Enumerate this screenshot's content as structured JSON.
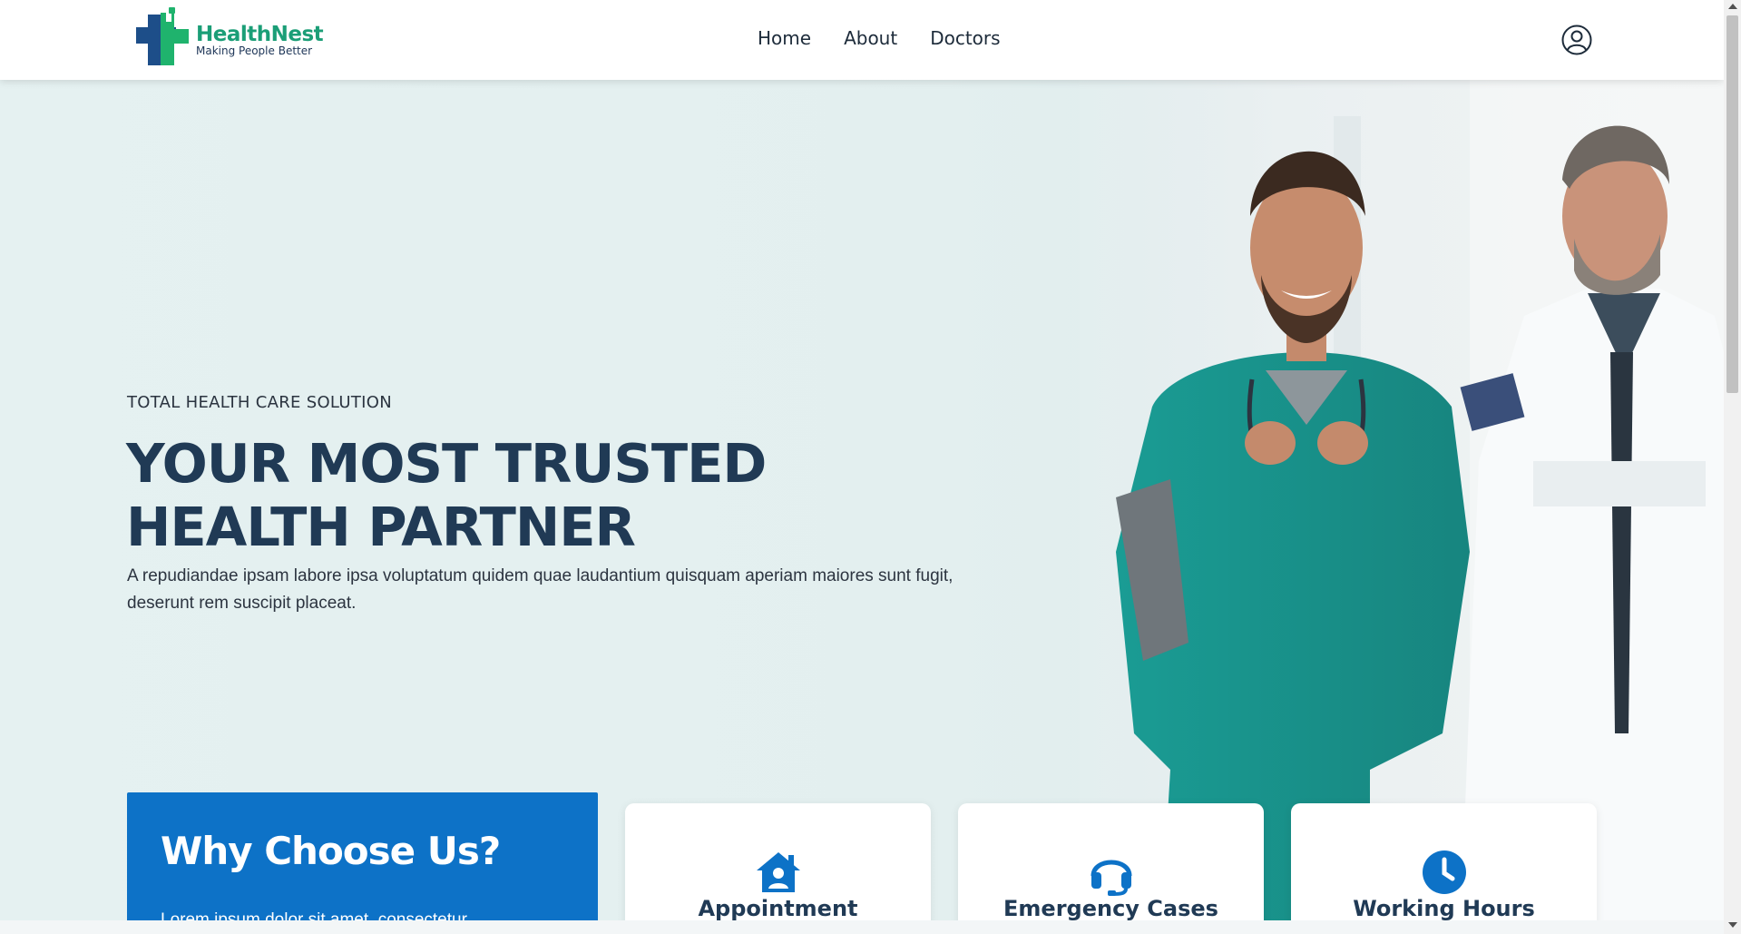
{
  "brand": {
    "name": "HealthNest",
    "tagline": "Making People Better",
    "colors": {
      "primary": "#0d72c7",
      "heading": "#203a55",
      "logo_green": "#1b9e77",
      "logo_blue": "#1d4e89"
    }
  },
  "nav": {
    "items": [
      {
        "label": "Home"
      },
      {
        "label": "About"
      },
      {
        "label": "Doctors"
      }
    ],
    "account_icon": "user-circle-icon"
  },
  "hero": {
    "eyebrow": "TOTAL HEALTH CARE SOLUTION",
    "headline_line1": "YOUR MOST TRUSTED",
    "headline_line2": "HEALTH PARTNER",
    "description": "A repudiandae ipsam labore ipsa voluptatum quidem quae laudantium quisquam aperiam maiores sunt fugit, deserunt rem suscipit placeat."
  },
  "features": {
    "why_title": "Why Choose Us?",
    "why_text": "Lorem ipsum dolor sit amet, consectetur",
    "cards": [
      {
        "label": "Appointment",
        "icon": "house-user-icon"
      },
      {
        "label": "Emergency Cases",
        "icon": "headset-icon"
      },
      {
        "label": "Working Hours",
        "icon": "clock-icon"
      }
    ]
  }
}
